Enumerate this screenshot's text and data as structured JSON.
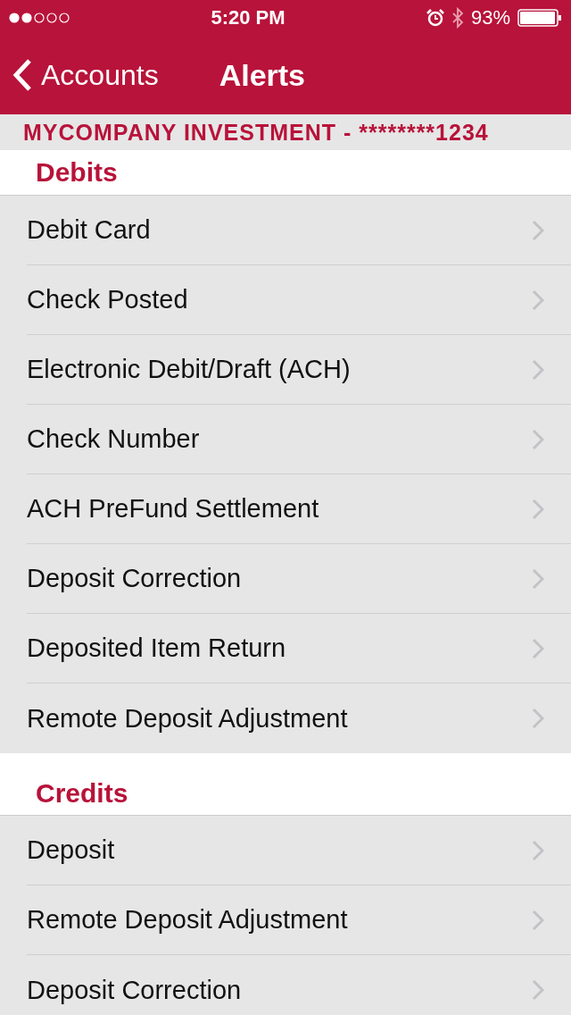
{
  "status_bar": {
    "time": "5:20 PM",
    "battery": "93%"
  },
  "nav": {
    "back": "Accounts",
    "title": "Alerts"
  },
  "account": "MYCOMPANY INVESTMENT - ********1234",
  "sections": [
    {
      "title": "Debits",
      "items": [
        "Debit Card",
        "Check Posted",
        "Electronic Debit/Draft (ACH)",
        "Check Number",
        "ACH PreFund Settlement",
        "Deposit Correction",
        "Deposited Item Return",
        "Remote Deposit Adjustment"
      ]
    },
    {
      "title": "Credits",
      "items": [
        "Deposit",
        "Remote Deposit Adjustment",
        "Deposit Correction"
      ]
    }
  ]
}
